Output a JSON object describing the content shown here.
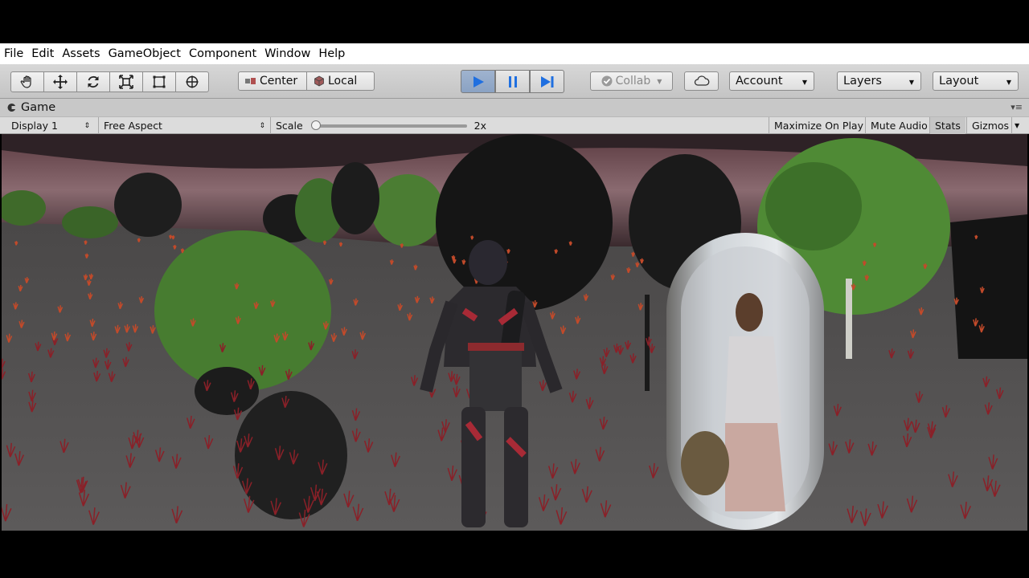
{
  "menu": [
    "File",
    "Edit",
    "Assets",
    "GameObject",
    "Component",
    "Window",
    "Help"
  ],
  "toolbar": {
    "tools": [
      {
        "name": "hand-tool-icon"
      },
      {
        "name": "move-tool-icon"
      },
      {
        "name": "rotate-tool-icon"
      },
      {
        "name": "scale-tool-icon"
      },
      {
        "name": "rect-tool-icon"
      },
      {
        "name": "transform-tool-icon"
      }
    ],
    "pivot_label": "Center",
    "space_label": "Local",
    "collab_label": "Collab",
    "account_label": "Account",
    "layers_label": "Layers",
    "layout_label": "Layout",
    "play_state": "playing",
    "accent_color": "#1f6fe0"
  },
  "game_tab": {
    "title": "Game",
    "display": "Display 1",
    "aspect": "Free Aspect",
    "scale_label": "Scale",
    "scale_value": "2x",
    "scale_level": 0,
    "maximize_label": "Maximize On Play",
    "mute_label": "Mute Audio",
    "stats_label": "Stats",
    "gizmos_label": "Gizmos"
  }
}
